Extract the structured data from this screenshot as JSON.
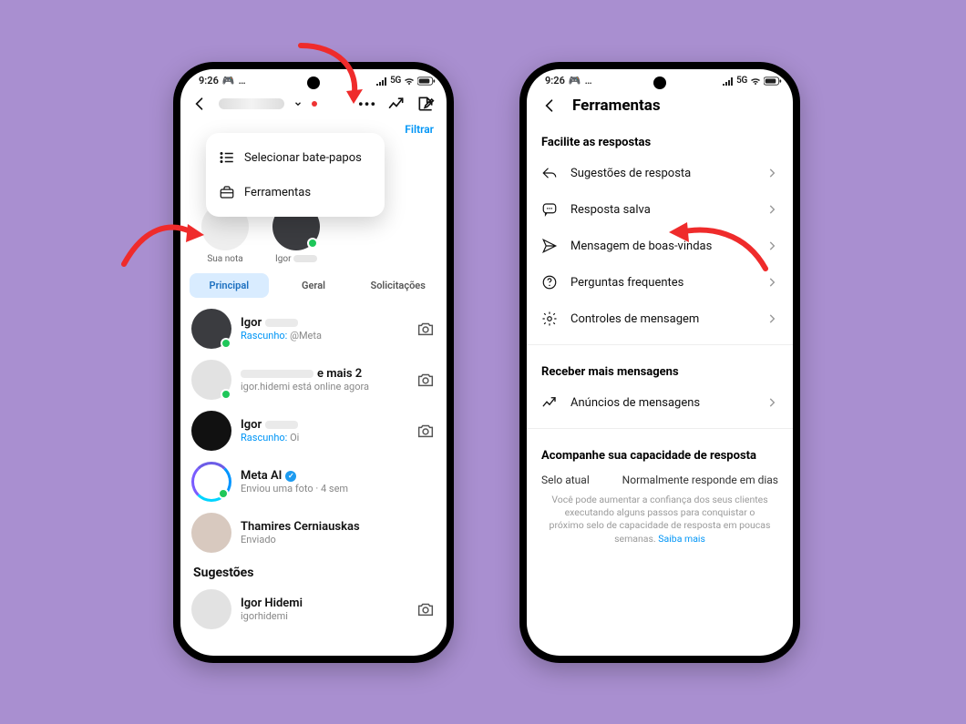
{
  "statusbar": {
    "time": "9:26",
    "net_label": "5G"
  },
  "header": {
    "filter": "Filtrar"
  },
  "menu": {
    "item1": "Selecionar bate-papos",
    "item2": "Ferramentas"
  },
  "stories": {
    "your_note": "Sua nota",
    "story_name": "Igor"
  },
  "tabs": {
    "main": "Principal",
    "general": "Geral",
    "requests": "Solicitações"
  },
  "chats": {
    "c1": {
      "name": "Igor",
      "draft_label": "Rascunho:",
      "draft_body": "@Meta"
    },
    "c2": {
      "suffix": "e mais 2",
      "sub": "igor.hidemi está online agora"
    },
    "c3": {
      "name": "Igor",
      "draft_label": "Rascunho:",
      "draft_body": "Oi"
    },
    "c4": {
      "name": "Meta AI",
      "sub": "Enviou uma foto · 4 sem"
    },
    "c5": {
      "name": "Thamires Cerniauskas",
      "sub": "Enviado"
    }
  },
  "suggestions_title": "Sugestões",
  "suggestion": {
    "name": "Igor Hidemi",
    "handle": "igorhidemi"
  },
  "tools": {
    "header": "Ferramentas",
    "group1": "Facilite as respostas",
    "r1": "Sugestões de resposta",
    "r2": "Resposta salva",
    "r3": "Mensagem de boas-vindas",
    "r4": "Perguntas frequentes",
    "r5": "Controles de mensagem",
    "group2": "Receber mais mensagens",
    "r6": "Anúncios de mensagens",
    "group3": "Acompanhe sua capacidade de resposta",
    "cap_left": "Selo atual",
    "cap_right": "Normalmente responde em dias",
    "cap_msg": "Você pode aumentar a confiança dos seus clientes executando alguns passos para conquistar o próximo selo de capacidade de resposta em poucas semanas.",
    "cap_more": "Saiba mais"
  }
}
